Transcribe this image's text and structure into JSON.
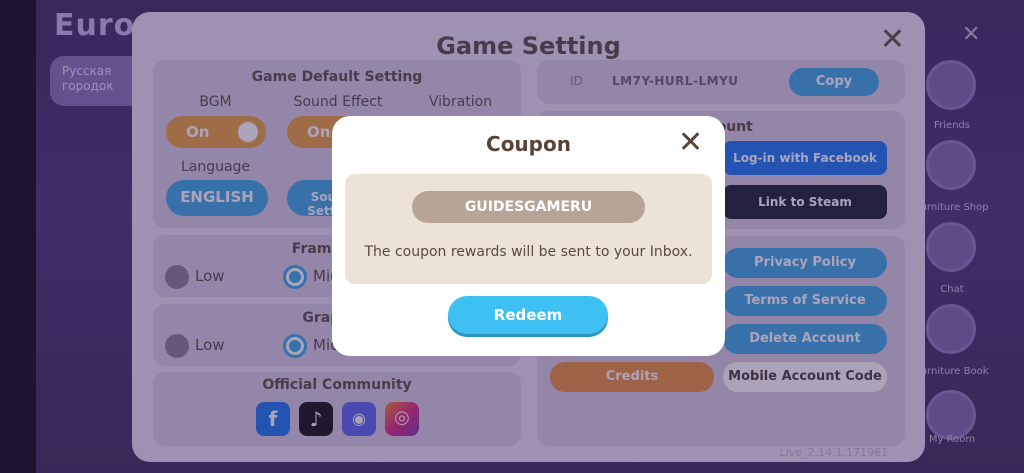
{
  "background": {
    "region_title": "Europ",
    "chip_text": "Русская городок",
    "side_labels": [
      "Friends",
      "Furniture Shop",
      "Chat",
      "Furniture Book",
      "My Room"
    ],
    "version": "Live_2.14.1.171961"
  },
  "settings": {
    "title": "Game Setting",
    "default_setting": {
      "heading": "Game Default Setting",
      "bgm_label": "BGM",
      "sound_label": "Sound Effect",
      "vibration_label": "Vibration",
      "bgm_value": "On",
      "sound_value": "On",
      "language_label": "Language",
      "language_value": "ENGLISH",
      "sound_setting_label": "Sound Setting"
    },
    "frame_rate": {
      "heading": "Frame Rate",
      "low": "Low",
      "mid": "Mid"
    },
    "graphics": {
      "heading": "Graphics",
      "low": "Low",
      "mid": "Mid"
    },
    "community": {
      "heading": "Official Community"
    },
    "account": {
      "id_label": "ID",
      "id_value": "LM7Y-HURL-LMYU",
      "copy_label": "Copy",
      "heading": "Account",
      "facebook_label": "Log-in with Facebook",
      "steam_label": "Link to Steam"
    },
    "menu": {
      "privacy": "Privacy Policy",
      "terms": "Terms of Service",
      "delete": "Delete Account",
      "credits": "Credits",
      "mobile_code": "Mobile Account Code"
    }
  },
  "coupon": {
    "title": "Coupon",
    "code_value": "GUIDESGAMERU",
    "message": "The coupon rewards will be sent to your Inbox.",
    "redeem_label": "Redeem"
  },
  "colors": {
    "accent_blue": "#3ec1f2",
    "toggle_orange": "#e8a23a",
    "facebook": "#1877f2",
    "steam": "#16202c"
  }
}
